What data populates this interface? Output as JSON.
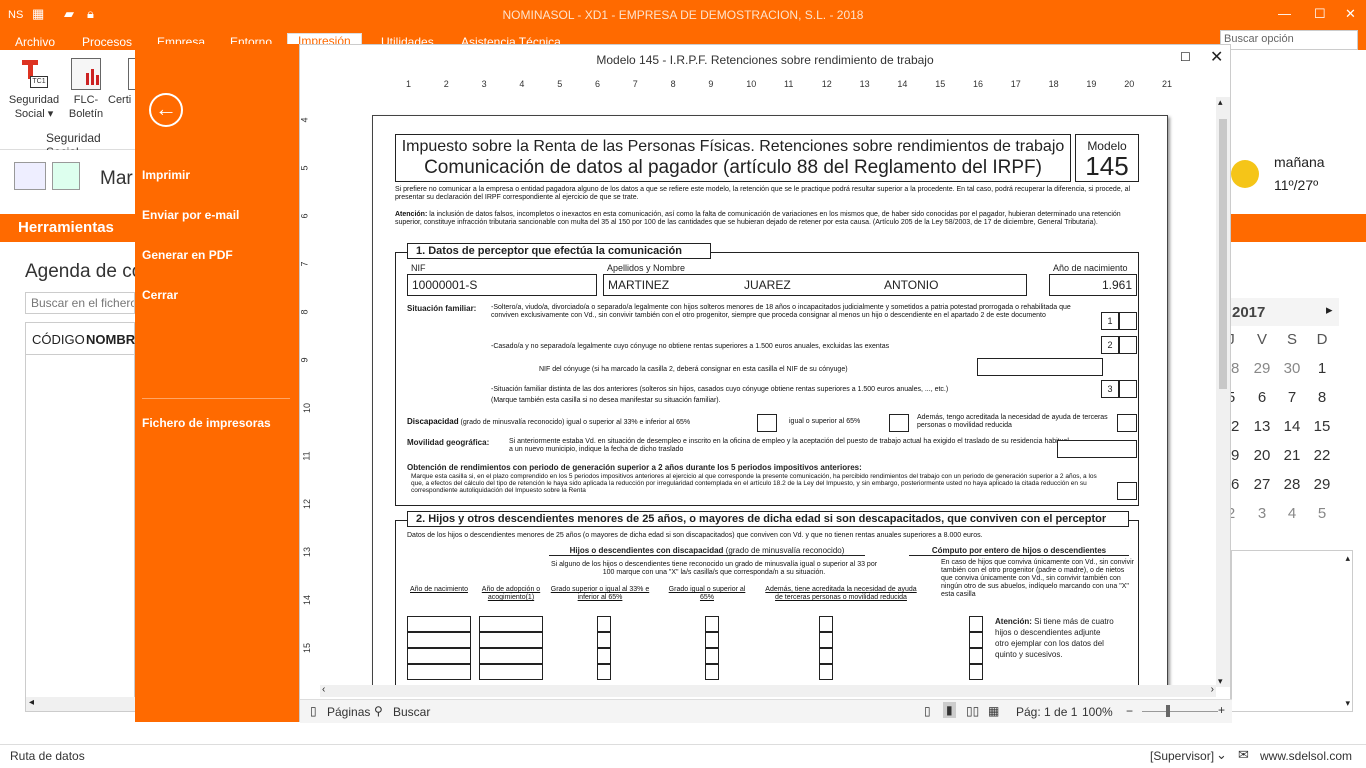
{
  "app": {
    "title": "NOMINASOL - XD1 - EMPRESA DE DEMOSTRACION, S.L. - 2018",
    "quick_access_label": "NS",
    "menu_tabs": [
      "Archivo",
      "Procesos",
      "Empresa",
      "Entorno",
      "Impresión",
      "Utilidades",
      "Asistencia Técnica"
    ],
    "search_placeholder": "Buscar opción"
  },
  "ribbon": {
    "btn_seg_label1": "Seguridad",
    "btn_seg_label2": "Social",
    "btn_flc_label1": "FLC-",
    "btn_flc_label2": "Boletín",
    "btn_cert_label": "Certi",
    "group_label": "Seguridad Social"
  },
  "background": {
    "truncated_heading": "Mar",
    "tools_label": "Herramientas",
    "agenda_title": "Agenda de co",
    "search_placeholder": "Buscar en el fichero",
    "col_codigo": "CÓDIGO",
    "col_nombre": "NOMBRE",
    "weather_day": "mañana",
    "weather_temp": "11º/27º",
    "cal_year": "2017",
    "cal_headers": [
      "J",
      "V",
      "S",
      "D"
    ],
    "cal_rows": [
      [
        "28",
        "29",
        "30",
        "1"
      ],
      [
        "5",
        "6",
        "7",
        "8"
      ],
      [
        "12",
        "13",
        "14",
        "15"
      ],
      [
        "19",
        "20",
        "21",
        "22"
      ],
      [
        "26",
        "27",
        "28",
        "29"
      ],
      [
        "2",
        "3",
        "4",
        "5"
      ]
    ]
  },
  "side": {
    "print": "Imprimir",
    "email": "Enviar por e-mail",
    "pdf": "Generar en PDF",
    "close": "Cerrar",
    "printers": "Fichero de impresoras"
  },
  "dialog": {
    "title": "Modelo 145 - I.R.P.F. Retenciones sobre rendimiento de trabajo",
    "ruler_top": [
      "1",
      "2",
      "3",
      "4",
      "5",
      "6",
      "7",
      "8",
      "9",
      "10",
      "11",
      "12",
      "13",
      "14",
      "15",
      "16",
      "17",
      "18",
      "19",
      "20",
      "21"
    ],
    "ruler_left": [
      "4",
      "5",
      "6",
      "7",
      "8",
      "9",
      "10",
      "11",
      "12",
      "13",
      "14",
      "15"
    ],
    "pages_btn": "Páginas",
    "search_btn": "Buscar",
    "page_info": "Pág: 1 de 1",
    "zoom": "100%"
  },
  "form": {
    "header_line1": "Impuesto sobre la Renta de las Personas Físicas. Retenciones sobre rendimientos de trabajo",
    "header_line2": "Comunicación de datos al pagador (artículo 88 del Reglamento del IRPF)",
    "modelo_label": "Modelo",
    "modelo_num": "145",
    "intro1": "Si prefiere no comunicar a la empresa o entidad pagadora alguno de los datos a que se refiere este modelo, la retención que se le practique podrá resultar superior a la procedente. En tal caso, podrá recuperar la diferencia, si procede, al presentar su declaración del IRPF correspondiente al ejercicio de que se trate.",
    "intro2_bold": "Atención:",
    "intro2": "la inclusión de datos falsos, incompletos o inexactos en esta comunicación, así como la falta de comunicación de variaciones en los mismos que, de haber sido conocidas por el pagador, hubieran determinado una retención superior, constituye infracción tributaria sancionable con multa del 35 al 150 por 100 de las cantidades que se hubieran dejado de retener por esta causa. (Artículo 205 de la Ley 58/2003, de 17 de diciembre, General Tributaria).",
    "sec1": "1. Datos de perceptor que efectúa la comunicación",
    "nif_label": "NIF",
    "nif_value": "10000001-S",
    "name_label": "Apellidos y Nombre",
    "surname1": "MARTINEZ",
    "surname2": "JUAREZ",
    "firstname": "ANTONIO",
    "birth_label": "Año de nacimiento",
    "birth_value": "1.961",
    "sit_label": "Situación familiar:",
    "sit1": "-Soltero/a, viudo/a, divorciado/a o separado/a legalmente con hijos solteros menores de 18 años o incapacitados judicialmente y sometidos a patria potestad prorrogada o rehabilitada que conviven exclusivamente con Vd., sin convivir también con el otro progenitor, siempre que proceda consignar al menos un hijo o descendiente en el apartado 2 de este documento",
    "sit2": "-Casado/a y no separado/a legalmente cuyo cónyuge no obtiene rentas superiores a 1.500 euros anuales, excluidas las exentas",
    "nif_conyuge": "NIF del cónyuge (si ha marcado la casilla 2, deberá consignar en esta casilla el NIF de su cónyuge)",
    "sit3": "-Situación familiar distinta de las dos anteriores (solteros sin hijos, casados cuyo cónyuge obtiene rentas superiores a 1.500 euros anuales, ..., etc.)",
    "sit3b": "(Marque también esta casilla si no desea manifestar su situación familiar).",
    "box1": "1",
    "box2": "2",
    "box3": "3",
    "disc_label": "Discapacidad",
    "disc_note": "(grado de minusvalía reconocido)",
    "disc_a": "igual o superior al 33% e inferior al 65%",
    "disc_b": "igual o superior al 65%",
    "disc_c": "Además, tengo acreditada la necesidad de ayuda de terceras personas o movilidad reducida",
    "mov_label": "Movilidad geográfica:",
    "mov_text": "Si anteriormente estaba Vd. en situación de desempleo e inscrito en la oficina de empleo y la aceptación del puesto de trabajo actual ha exigido el traslado de su residencia habitual a un nuevo municipio, indique la fecha de dicho traslado",
    "obt_label": "Obtención de rendimientos con periodo de generación superior a 2 años durante los 5 periodos impositivos anteriores:",
    "obt_text": "Marque esta casilla si, en el plazo comprendido en los 5 periodos impositivos anteriores al ejercicio al que corresponde la presente comunicación, ha percibido rendimientos del trabajo con un periodo de generación superior a 2 años, a los que, a efectos del cálculo del tipo de retención le haya sido aplicada la reducción por irregularidad contemplada en el artículo 18.2 de la Ley del Impuesto, y sin embargo, posteriormente usted no haya aplicado la citada reducción en su correspondiente autoliquidación del Impuesto sobre la Renta",
    "sec2": "2. Hijos y otros descendientes menores de 25 años, o mayores de dicha edad si son descapacitados, que conviven con el perceptor",
    "sec2_intro": "Datos de los hijos o descendientes menores de 25 años (o mayores de dicha edad si son discapacitados) que conviven con Vd. y que no tienen rentas anuales superiores a 8.000 euros.",
    "hijos_disc": "Hijos o descendientes con discapacidad",
    "hijos_disc_note": "(grado de minusvalía reconocido)",
    "computo": "Cómputo por entero de hijos o descendientes",
    "hijos_note": "Si alguno de los hijos o descendientes tiene reconocido un grado de minusvalía igual o superior al 33 por 100 marque con una \"X\" la/s casilla/s que corresponda/n a su situación.",
    "computo_note": "En caso de hijos que conviva únicamente con Vd., sin convivir también con el otro progenitor (padre o madre), o de nietos que conviva únicamente con Vd., sin convivir también con ningún otro de sus abuelos, indíquelo marcando con una \"X\" esta casilla",
    "col_birth": "Año de nacimiento",
    "col_adopt": "Año de adopción o acogimiento(1)",
    "col_33": "Grado superior o igual al 33% e inferior al 65%",
    "col_65": "Grado igual o superior al 65%",
    "col_help": "Además, tiene acreditada la necesidad de ayuda de terceras personas o movilidad reducida",
    "atencion_bold": "Atención:",
    "atencion": "Si tiene más de cuatro hijos o descendientes adjunte otro ejemplar con los datos del quinto y sucesivos."
  },
  "footer": {
    "left": "Ruta de datos",
    "user": "[Supervisor]",
    "web": "www.sdelsol.com"
  }
}
